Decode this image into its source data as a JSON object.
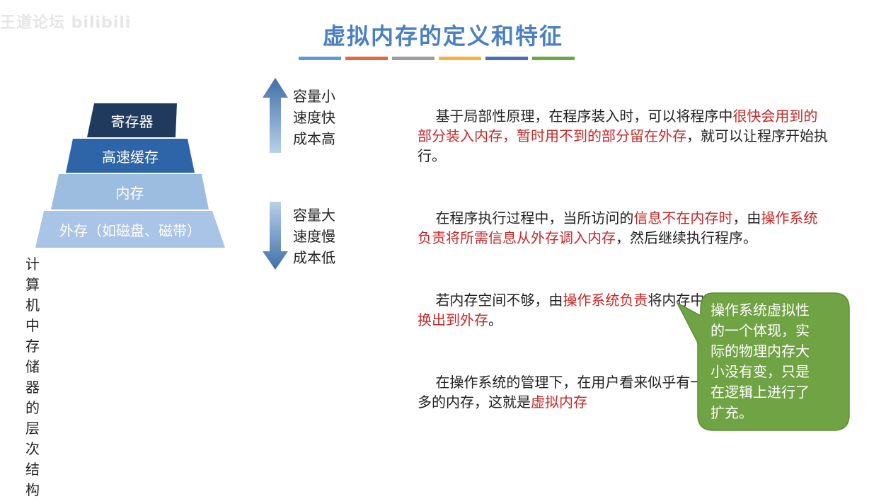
{
  "watermark": "王道论坛 bilibili",
  "title": "虚拟内存的定义和特征",
  "colors": {
    "title": "#4a7fc1",
    "bars": [
      "#5b9bd5",
      "#e06a3b",
      "#9e9e9e",
      "#f2b340",
      "#4a6db3",
      "#6aaa45"
    ],
    "highlight": "#c62828",
    "callout": "#70a344"
  },
  "pyramid": {
    "tiers": [
      "寄存器",
      "高速缓存",
      "内存",
      "外存（如磁盘、磁带）"
    ],
    "caption": "计算机中存储器的层次结构"
  },
  "arrows": {
    "up_icon": "arrow-up-icon",
    "down_icon": "arrow-down-icon",
    "up_label": [
      "容量小",
      "速度快",
      "成本高"
    ],
    "down_label": [
      "容量大",
      "速度慢",
      "成本低"
    ]
  },
  "paragraphs": [
    [
      {
        "t": "基于局部性原理，在程序装入时，可以将程序中",
        "h": false
      },
      {
        "t": "很快会用到的部分装入内存，暂时用不到的部分留在外存",
        "h": true
      },
      {
        "t": "，就可以让程序开始执行。",
        "h": false
      }
    ],
    [
      {
        "t": "在程序执行过程中，当所访问的",
        "h": false
      },
      {
        "t": "信息不在内存时",
        "h": true
      },
      {
        "t": "，由",
        "h": false
      },
      {
        "t": "操作系统负责将所需信息从外存调入内存",
        "h": true
      },
      {
        "t": "，然后继续执行程序。",
        "h": false
      }
    ],
    [
      {
        "t": "若内存空间不够，由",
        "h": false
      },
      {
        "t": "操作系统负责",
        "h": true
      },
      {
        "t": "将内存中",
        "h": false
      },
      {
        "t": "暂时用不到的信息换出到外存",
        "h": true
      },
      {
        "t": "。",
        "h": false
      }
    ],
    [
      {
        "t": "在操作系统的管理下，在用户看来似乎有一个比实际内存大得多的内存，这就是",
        "h": false
      },
      {
        "t": "虚拟内存",
        "h": true
      }
    ]
  ],
  "callout": {
    "text": "操作系统虚拟性\n的一个体现，实\n际的物理内存大\n小没有变，只是\n在逻辑上进行了\n扩充。"
  }
}
